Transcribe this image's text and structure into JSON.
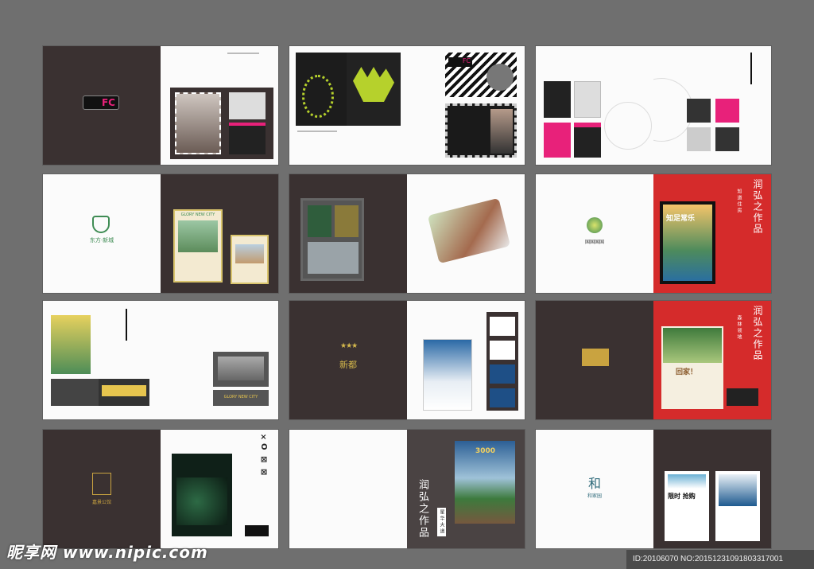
{
  "colors": {
    "background": "#6f6f6f",
    "dark_page": "#3a3131",
    "red_page": "#d52b2b",
    "white_page": "#fbfbfb",
    "fc_pink": "#e8217a",
    "fingerprint_green": "#b6d12c"
  },
  "spread1": {
    "fc_logo": "FC",
    "fc_logo_small": "FC"
  },
  "spread2": {
    "fc_logo": "FC",
    "fc_logo_small": "FC"
  },
  "spread4": {
    "logo_text": "东方·新城",
    "poster_title": "GLORY NEW CITY"
  },
  "spread6": {
    "logo_caption": "国国国国",
    "poster_headline": "知足常乐",
    "series_title": "润弘之作品",
    "sub_title": "知道住房"
  },
  "spread7": {
    "billboard_title": "GLORY NEW CITY"
  },
  "spread8": {
    "logo_text": "新都"
  },
  "spread9": {
    "poster_headline": "回家！",
    "series_title": "润弘之作品",
    "sub_title": "森林领地"
  },
  "spread10": {
    "logo_text": "嘉景公馆",
    "side_code": "×O ⊠ ⊠"
  },
  "spread11": {
    "series_title": "润弘之作品",
    "sub_title": "星华大道",
    "poster_price": "3000"
  },
  "spread12": {
    "logo_text": "和家园",
    "poster_text": "限时 抢购"
  },
  "watermark": {
    "site": "昵享网 www.nipic.com",
    "id_text": "ID:20106070 NO:20151231091803317001"
  }
}
